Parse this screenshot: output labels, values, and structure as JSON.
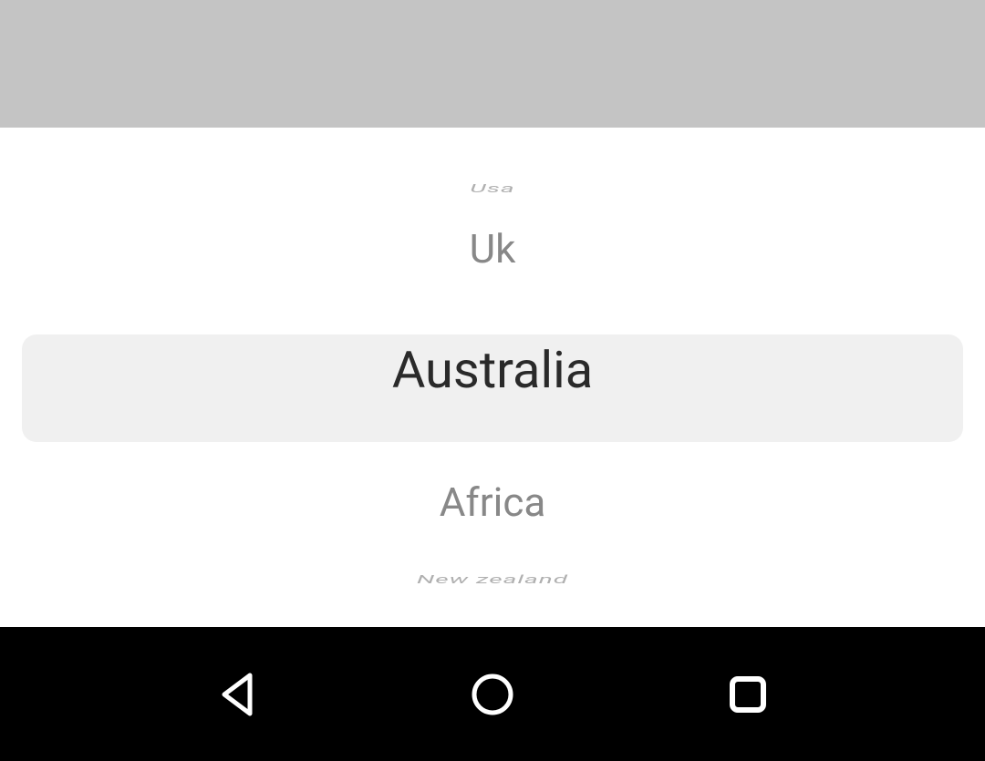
{
  "picker": {
    "items": [
      "Usa",
      "Uk",
      "Australia",
      "Africa",
      "New zealand"
    ],
    "selectedIndex": 2
  },
  "nav": {
    "back": "Back",
    "home": "Home",
    "recent": "Recent apps"
  }
}
